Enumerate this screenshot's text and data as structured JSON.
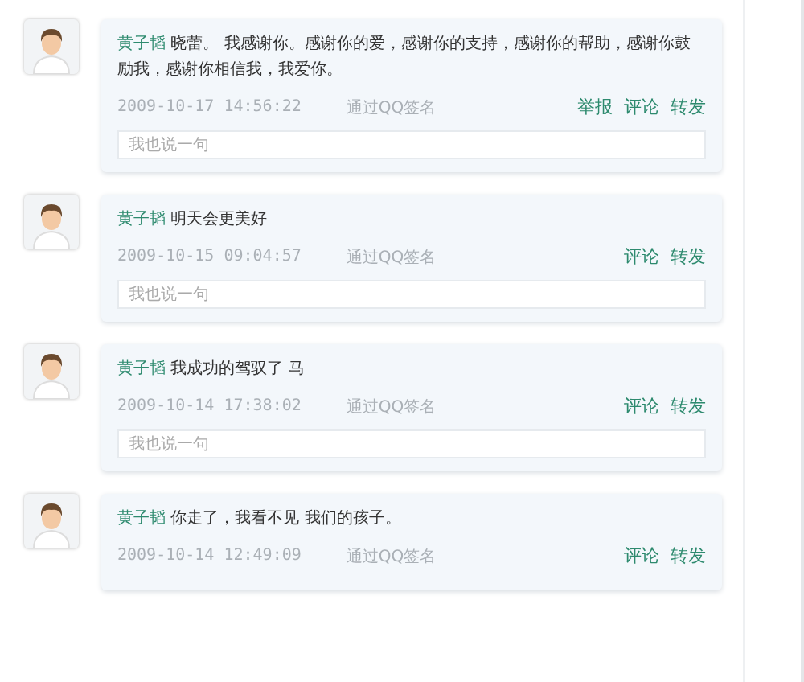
{
  "posts": [
    {
      "author": "黄子韬",
      "text": "晓蕾。 我感谢你。感谢你的爱，感谢你的支持，感谢你的帮助，感谢你鼓励我，感谢你相信我，我爱你。",
      "time": "2009-10-17 14:56:22",
      "source": "通过QQ签名",
      "actions": [
        "举报",
        "评论",
        "转发"
      ],
      "reply_placeholder": "我也说一句"
    },
    {
      "author": "黄子韬",
      "text": "明天会更美好",
      "time": "2009-10-15 09:04:57",
      "source": "通过QQ签名",
      "actions": [
        "评论",
        "转发"
      ],
      "reply_placeholder": "我也说一句"
    },
    {
      "author": "黄子韬",
      "text": "我成功的驾驭了 马",
      "time": "2009-10-14 17:38:02",
      "source": "通过QQ签名",
      "actions": [
        "评论",
        "转发"
      ],
      "reply_placeholder": "我也说一句"
    },
    {
      "author": "黄子韬",
      "text": "你走了，我看不见 我们的孩子。",
      "time": "2009-10-14 12:49:09",
      "source": "通过QQ签名",
      "actions": [
        "评论",
        "转发"
      ]
    }
  ]
}
